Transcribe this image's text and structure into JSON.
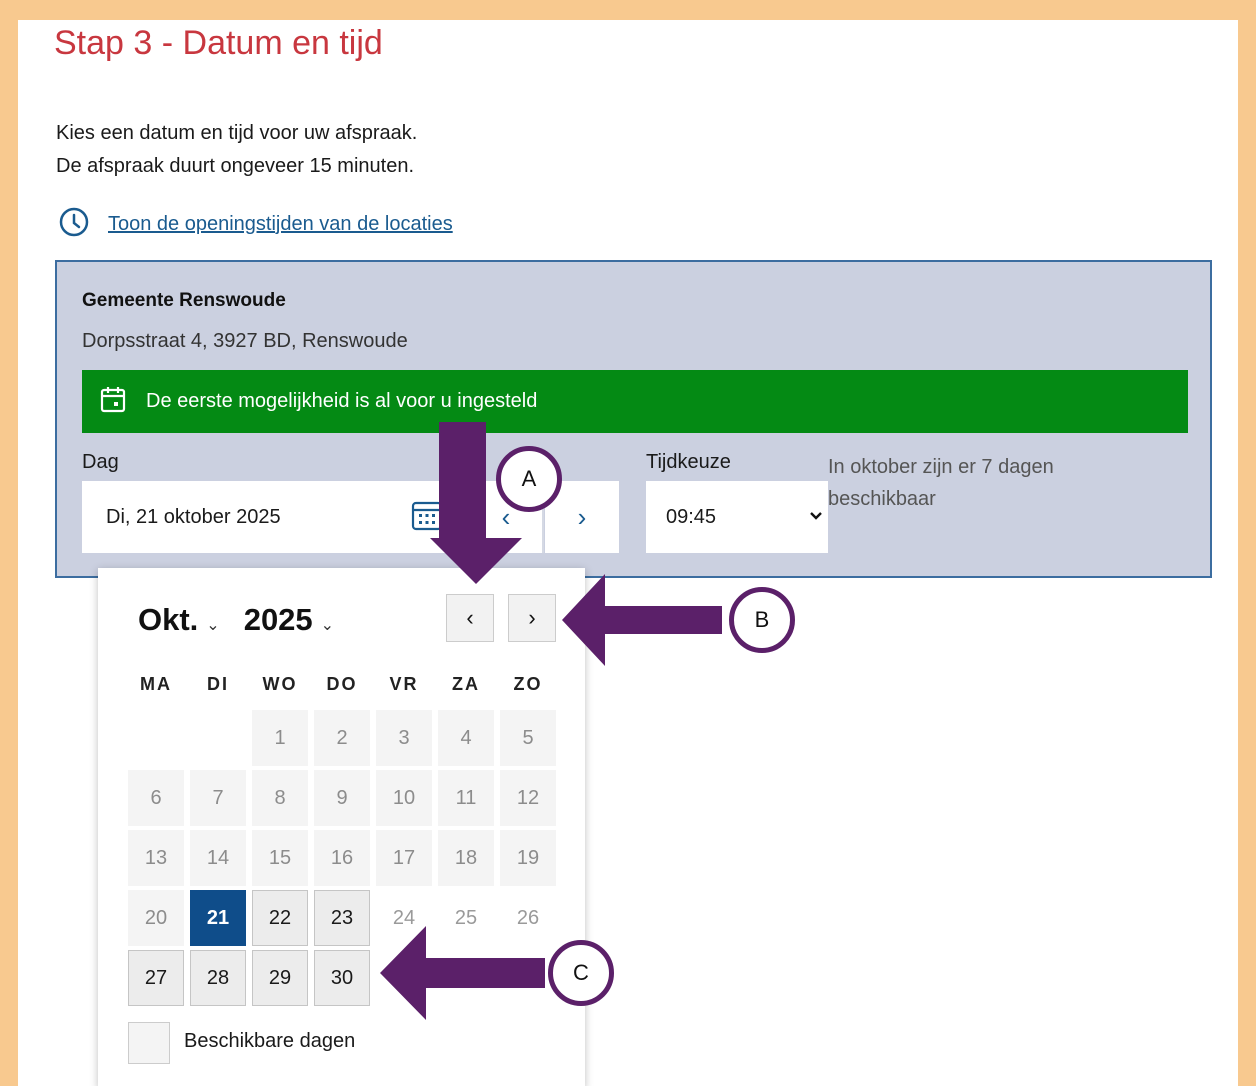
{
  "page": {
    "title": "Stap 3 - Datum en tijd",
    "intro_line1": "Kies een datum en tijd voor uw afspraak.",
    "intro_line2": "De afspraak duurt ongeveer 15 minuten.",
    "hours_link": "Toon de openingstijden van de locaties"
  },
  "location": {
    "name": "Gemeente Renswoude",
    "address": "Dorpsstraat 4, 3927 BD, Renswoude",
    "notice": "De eerste mogelijkheid is al voor u ingesteld"
  },
  "form": {
    "day_label": "Dag",
    "day_value": "Di, 21 oktober 2025",
    "time_label": "Tijdkeuze",
    "time_value": "09:45",
    "availability_note": "In oktober zijn er 7 dagen beschikbaar",
    "prev_glyph": "‹",
    "next_glyph": "›"
  },
  "datepicker": {
    "month": "Okt.",
    "year": "2025",
    "prev_glyph": "‹",
    "next_glyph": "›",
    "weekdays": [
      "MA",
      "DI",
      "WO",
      "DO",
      "VR",
      "ZA",
      "ZO"
    ],
    "weeks": [
      [
        null,
        null,
        1,
        2,
        3,
        4,
        5
      ],
      [
        6,
        7,
        8,
        9,
        10,
        11,
        12
      ],
      [
        13,
        14,
        15,
        16,
        17,
        18,
        19
      ],
      [
        20,
        21,
        22,
        23,
        24,
        25,
        26
      ],
      [
        27,
        28,
        29,
        30,
        null,
        null,
        null
      ]
    ],
    "available_days": [
      21,
      22,
      23,
      27,
      28,
      29,
      30
    ],
    "selected_day": 21,
    "legend": "Beschikbare dagen"
  },
  "annotations": {
    "a": "A",
    "b": "B",
    "c": "C",
    "color": "#5b2069"
  },
  "colors": {
    "title": "#c8373f",
    "notice_bg": "#048a14",
    "panel_bg": "#cbd0e0",
    "selected_day": "#0f4d8a",
    "link": "#1a5b8f"
  }
}
